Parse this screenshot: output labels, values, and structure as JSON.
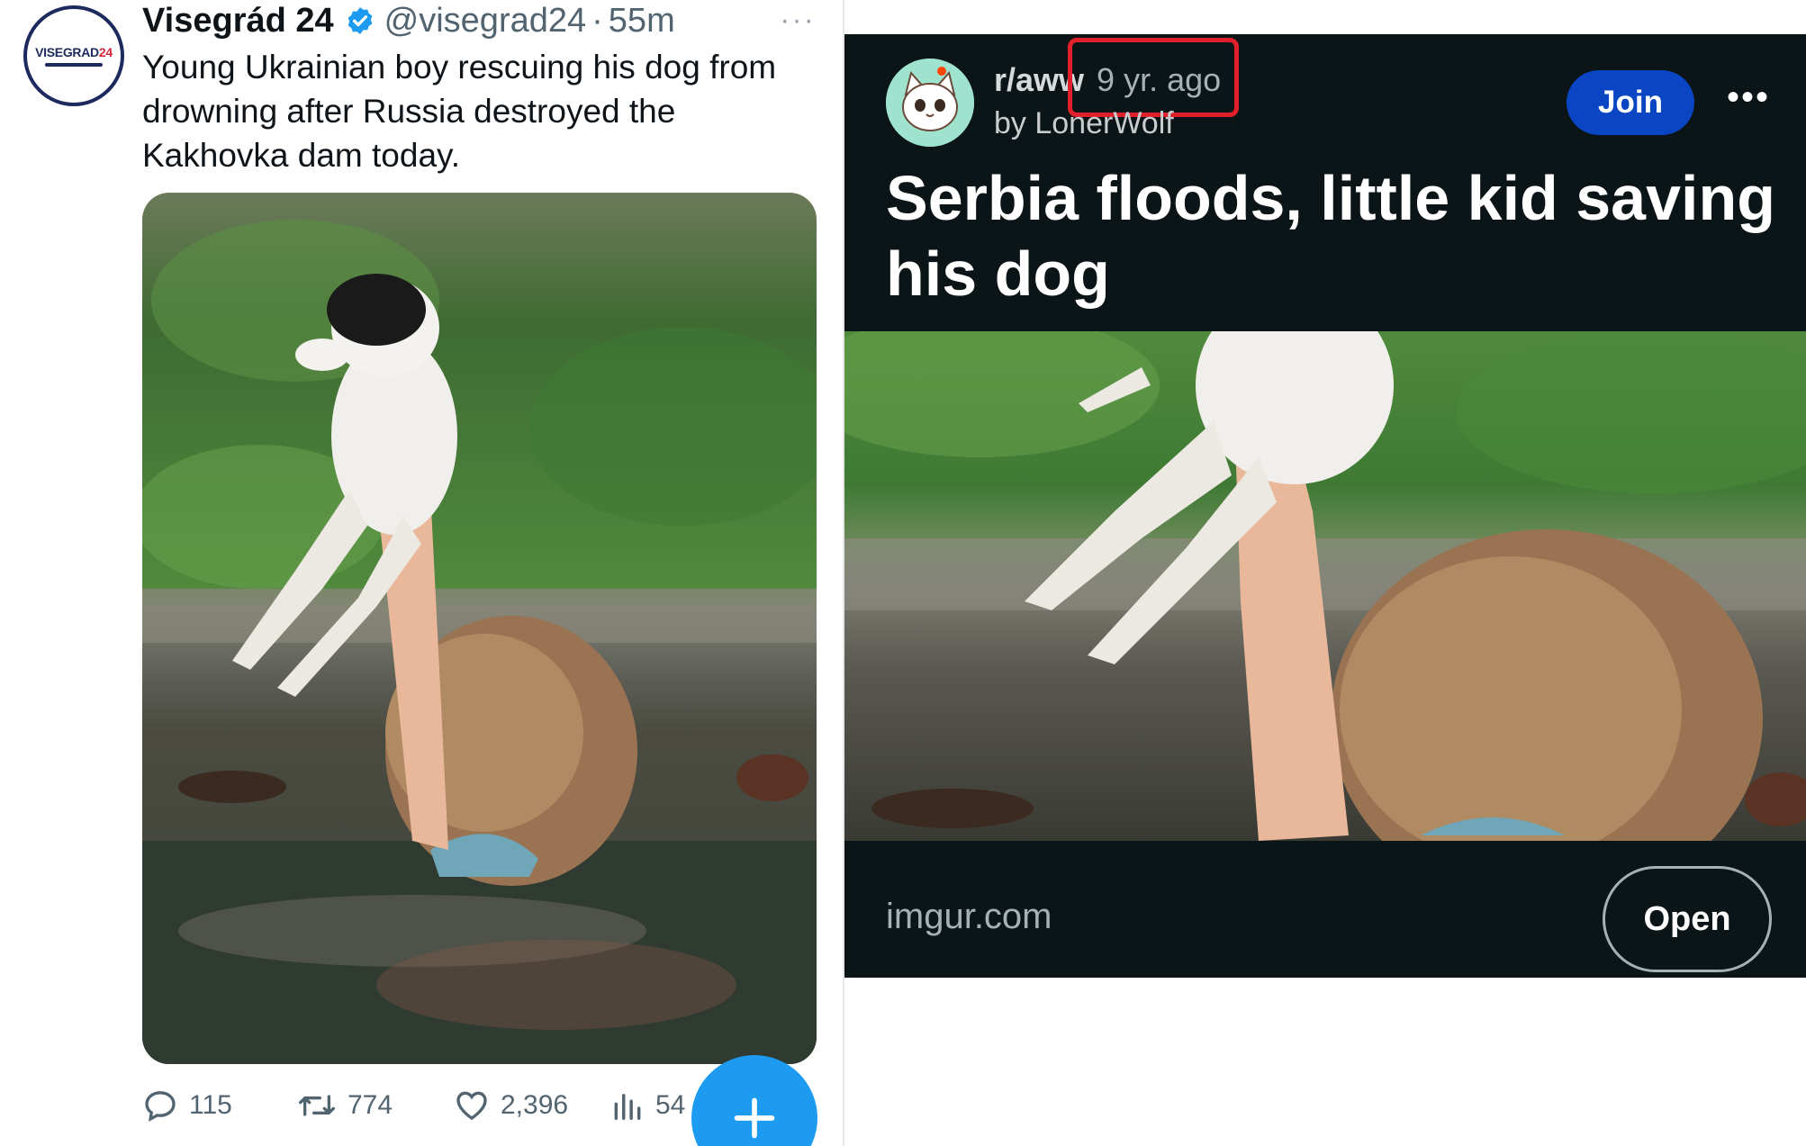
{
  "tweet": {
    "display_name": "Visegrád 24",
    "handle": "@visegrad24",
    "separator": "·",
    "time": "55m",
    "more_label": "···",
    "avatar_logo": {
      "main": "VISEGRAD",
      "accent": "24"
    },
    "text": "Young Ukrainian boy rescuing his dog from drowning after Russia destroyed the Kakhovka dam today.",
    "actions": {
      "replies": "115",
      "retweets": "774",
      "likes": "2,396",
      "views": "54"
    },
    "icons": [
      "verified-badge-icon",
      "more-icon",
      "reply-icon",
      "retweet-icon",
      "like-icon",
      "views-icon",
      "compose-plus-icon"
    ],
    "colors": {
      "accent": "#1d9bf0",
      "text": "#0f1419",
      "muted": "#536471"
    }
  },
  "reddit": {
    "subreddit": "r/aww",
    "time_ago": "9 yr. ago",
    "author_line": "by LonerWolf",
    "join_label": "Join",
    "more_label": "•••",
    "title": "Serbia floods, little kid saving his dog",
    "domain": "imgur.com",
    "open_label": "Open",
    "colors": {
      "background": "#0b1416",
      "join": "#0a45c4",
      "highlight": "#e0202a"
    }
  }
}
